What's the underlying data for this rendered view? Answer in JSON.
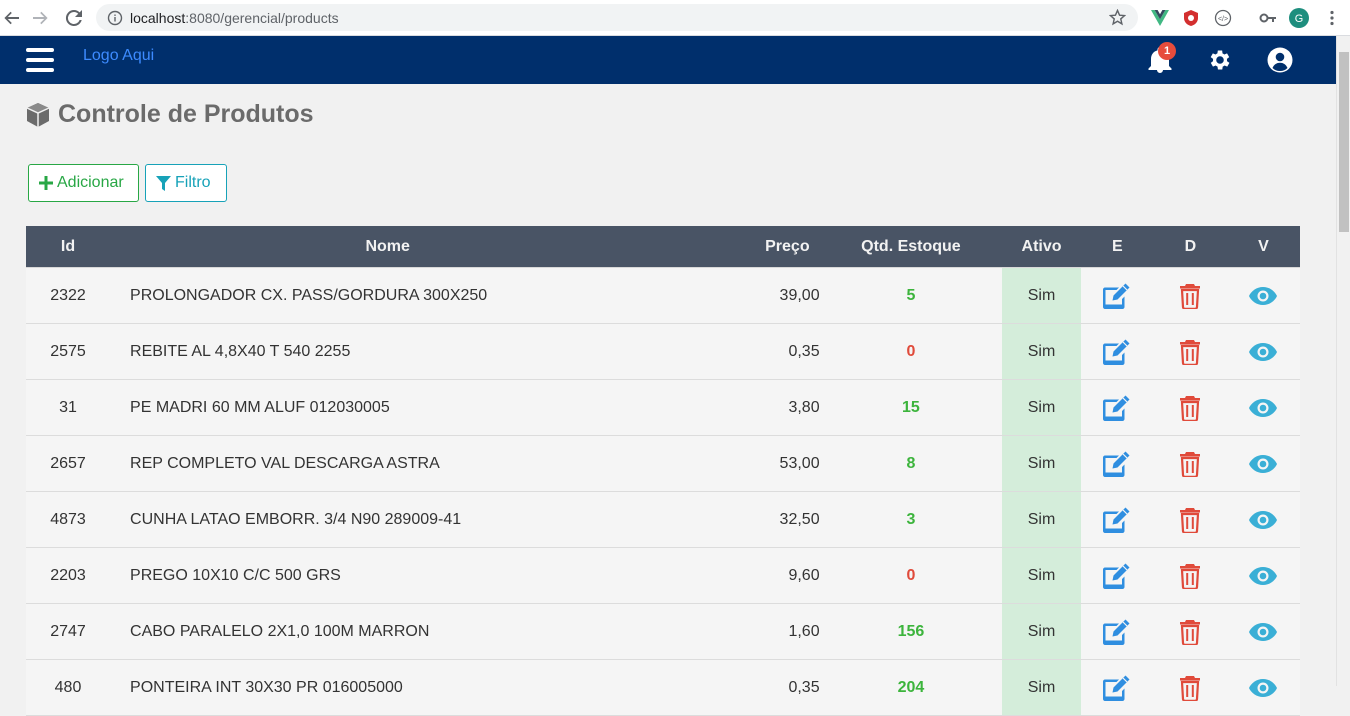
{
  "browser": {
    "url_host": "localhost",
    "url_path": ":8080/gerencial/products"
  },
  "header": {
    "logo_text": "Logo Aqui",
    "notification_count": "1"
  },
  "page": {
    "title": "Controle de Produtos",
    "add_button": "Adicionar",
    "filter_button": "Filtro"
  },
  "table": {
    "headers": {
      "id": "Id",
      "nome": "Nome",
      "preco": "Preço",
      "qtd": "Qtd. Estoque",
      "ativo": "Ativo",
      "e": "E",
      "d": "D",
      "v": "V"
    },
    "rows": [
      {
        "id": "2322",
        "nome": "PROLONGADOR CX. PASS/GORDURA 300X250",
        "preco": "39,00",
        "qtd": "5",
        "qtd_status": "green",
        "ativo": "Sim"
      },
      {
        "id": "2575",
        "nome": "REBITE AL 4,8X40 T 540  2255",
        "preco": "0,35",
        "qtd": "0",
        "qtd_status": "red",
        "ativo": "Sim"
      },
      {
        "id": "31",
        "nome": "PE MADRI 60 MM ALUF 012030005",
        "preco": "3,80",
        "qtd": "15",
        "qtd_status": "green",
        "ativo": "Sim"
      },
      {
        "id": "2657",
        "nome": "REP COMPLETO VAL DESCARGA ASTRA",
        "preco": "53,00",
        "qtd": "8",
        "qtd_status": "green",
        "ativo": "Sim"
      },
      {
        "id": "4873",
        "nome": "CUNHA LATAO EMBORR. 3/4 N90 289009-41",
        "preco": "32,50",
        "qtd": "3",
        "qtd_status": "green",
        "ativo": "Sim"
      },
      {
        "id": "2203",
        "nome": "PREGO 10X10 C/C  500 GRS",
        "preco": "9,60",
        "qtd": "0",
        "qtd_status": "red",
        "ativo": "Sim"
      },
      {
        "id": "2747",
        "nome": "CABO PARALELO 2X1,0 100M MARRON",
        "preco": "1,60",
        "qtd": "156",
        "qtd_status": "green",
        "ativo": "Sim"
      },
      {
        "id": "480",
        "nome": "PONTEIRA INT 30X30 PR 016005000",
        "preco": "0,35",
        "qtd": "204",
        "qtd_status": "green",
        "ativo": "Sim"
      }
    ]
  },
  "icons": {
    "menu": "hamburger-icon",
    "notifications": "bell-icon",
    "settings": "gear-icon",
    "account": "user-circle-icon",
    "title": "cube-icon",
    "add": "plus-icon",
    "filter": "filter-icon",
    "edit": "edit-icon",
    "delete": "trash-icon",
    "view": "eye-icon"
  },
  "colors": {
    "header_bg": "#002f6c",
    "table_header_bg": "#495465",
    "active_cell_bg": "#d4edda",
    "stock_ok": "#3cb43c",
    "stock_zero": "#e04a3a",
    "edit": "#2f8ee0",
    "delete": "#e04a3a",
    "view": "#3aafd6"
  }
}
